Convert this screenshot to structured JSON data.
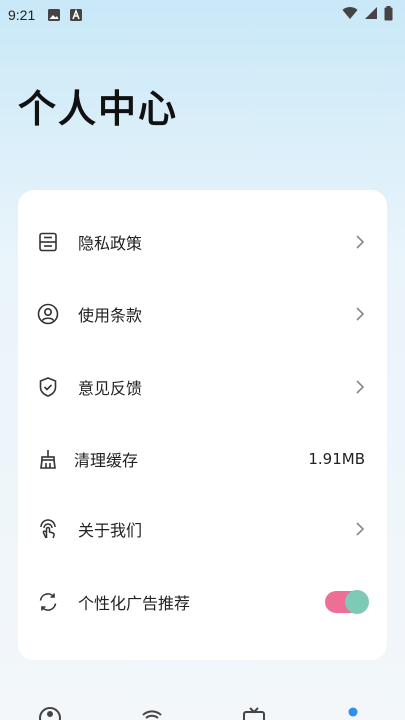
{
  "status_bar": {
    "time": "9:21"
  },
  "page": {
    "title": "个人中心"
  },
  "menu": [
    {
      "label": "隐私政策",
      "icon": "document-icon",
      "trailing": "chevron"
    },
    {
      "label": "使用条款",
      "icon": "user-circle-icon",
      "trailing": "chevron"
    },
    {
      "label": "意见反馈",
      "icon": "shield-check-icon",
      "trailing": "chevron"
    },
    {
      "label": "清理缓存",
      "icon": "broom-icon",
      "trailing": "value",
      "value": "1.91MB"
    },
    {
      "label": "关于我们",
      "icon": "hand-touch-icon",
      "trailing": "chevron"
    },
    {
      "label": "个性化广告推荐",
      "icon": "refresh-icon",
      "trailing": "toggle",
      "toggle_on": true
    }
  ],
  "colors": {
    "toggle_track": "#ee6f95",
    "toggle_knob": "#7fc9b8",
    "nav_active": "#2d8ff0"
  },
  "bottom_nav": {
    "items": [
      {
        "icon": "explore-icon",
        "active": false
      },
      {
        "icon": "wifi-icon",
        "active": false
      },
      {
        "icon": "tv-icon",
        "active": false
      },
      {
        "icon": "profile-dot-icon",
        "active": true
      }
    ]
  }
}
